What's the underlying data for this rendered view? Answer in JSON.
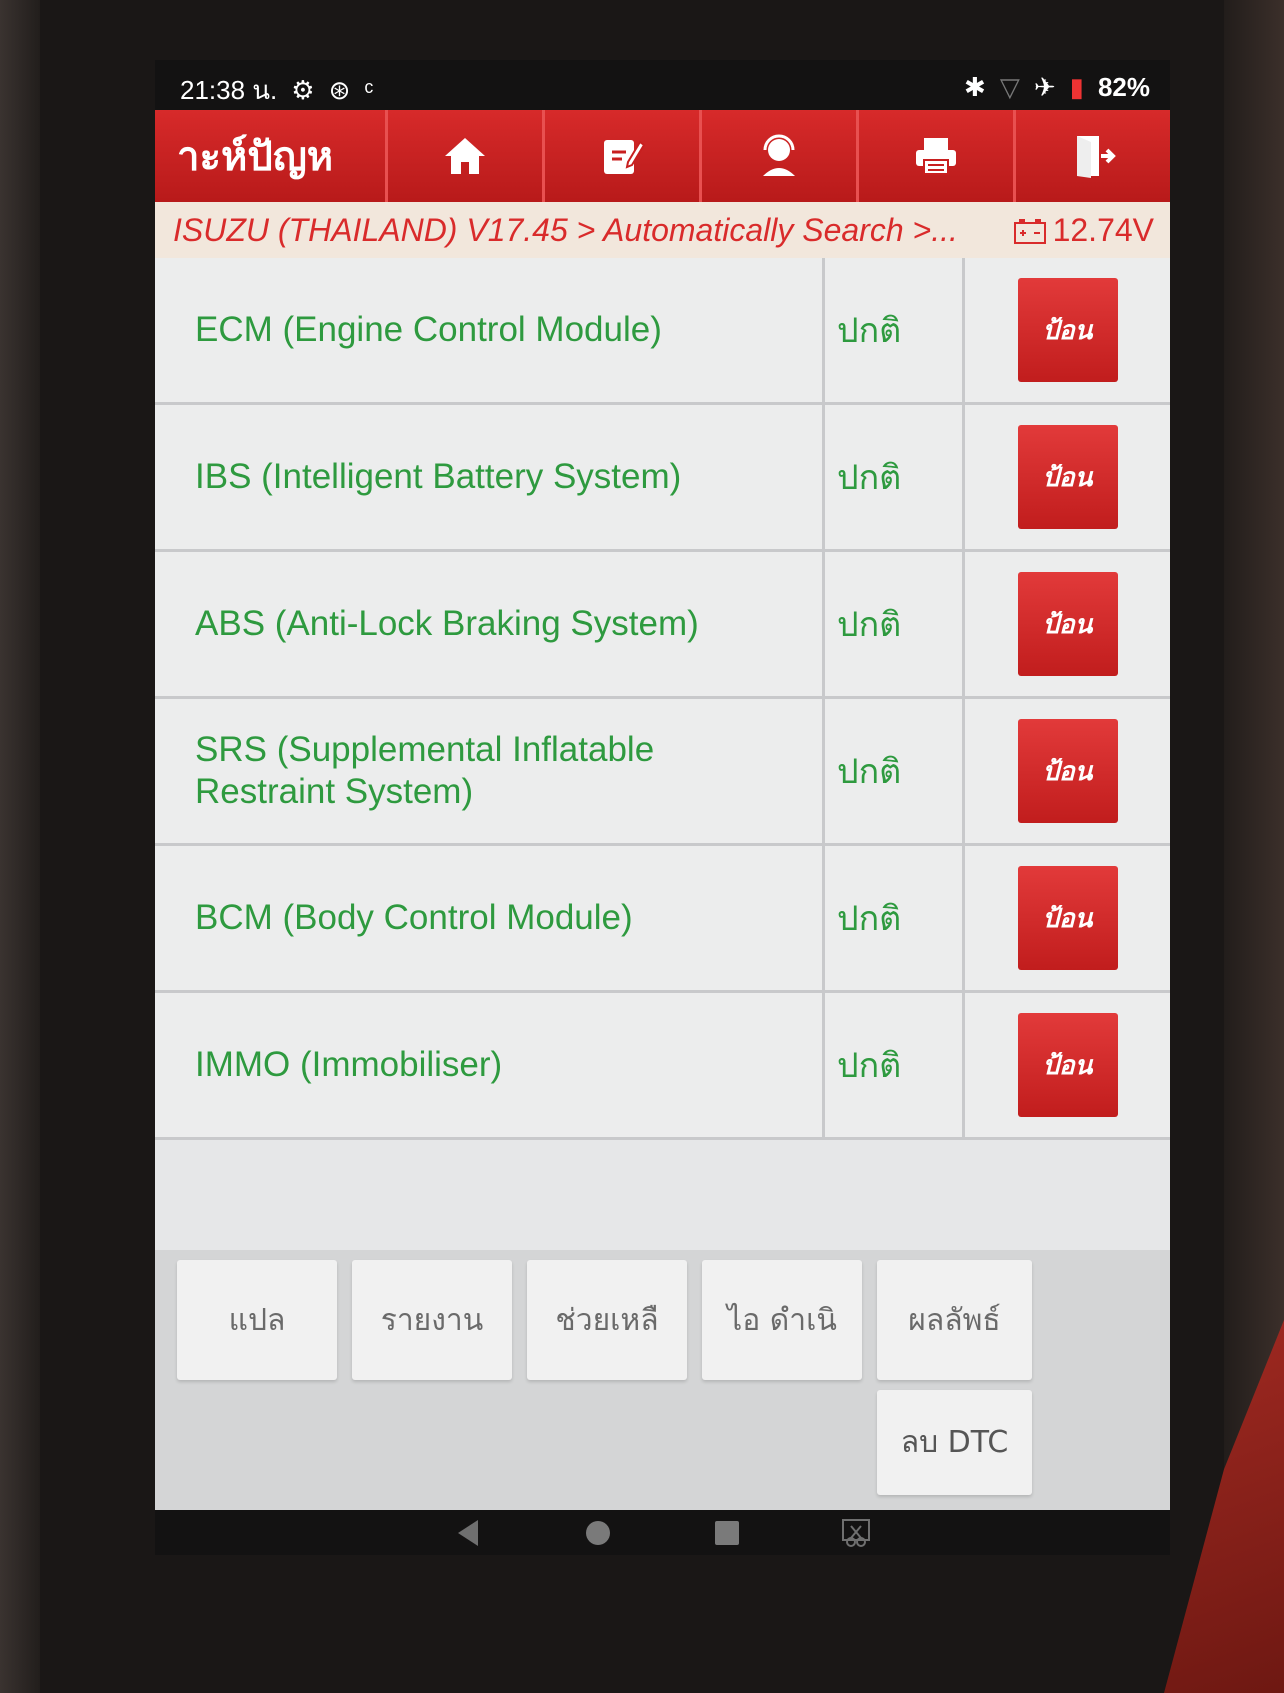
{
  "status_bar": {
    "time": "21:38 น.",
    "battery": "82%"
  },
  "toolbar": {
    "title": "าะห์ปัญห"
  },
  "breadcrumb": {
    "path": "ISUZU (THAILAND) V17.45 > Automatically Search >...",
    "voltage": "12.74V"
  },
  "systems": [
    {
      "name": "ECM (Engine Control Module)",
      "status": "ปกติ",
      "action": "ป้อน"
    },
    {
      "name": "IBS (Intelligent Battery System)",
      "status": "ปกติ",
      "action": "ป้อน"
    },
    {
      "name": "ABS (Anti-Lock Braking System)",
      "status": "ปกติ",
      "action": "ป้อน"
    },
    {
      "name": "SRS (Supplemental Inflatable Restraint System)",
      "status": "ปกติ",
      "action": "ป้อน"
    },
    {
      "name": "BCM (Body Control Module)",
      "status": "ปกติ",
      "action": "ป้อน"
    },
    {
      "name": "IMMO (Immobiliser)",
      "status": "ปกติ",
      "action": "ป้อน"
    }
  ],
  "bottom_buttons": {
    "translate": "แปล",
    "report": "รายงาน",
    "help": "ช่วยเหลื",
    "continue": "ไอ ดำเนิ",
    "result": "ผลลัพธ์",
    "clear_dtc": "ลบ DTC"
  },
  "colors": {
    "toolbar_red": "#c81f1f",
    "system_text_green": "#2e9a3f",
    "breadcrumb_text": "#d92b2b"
  }
}
